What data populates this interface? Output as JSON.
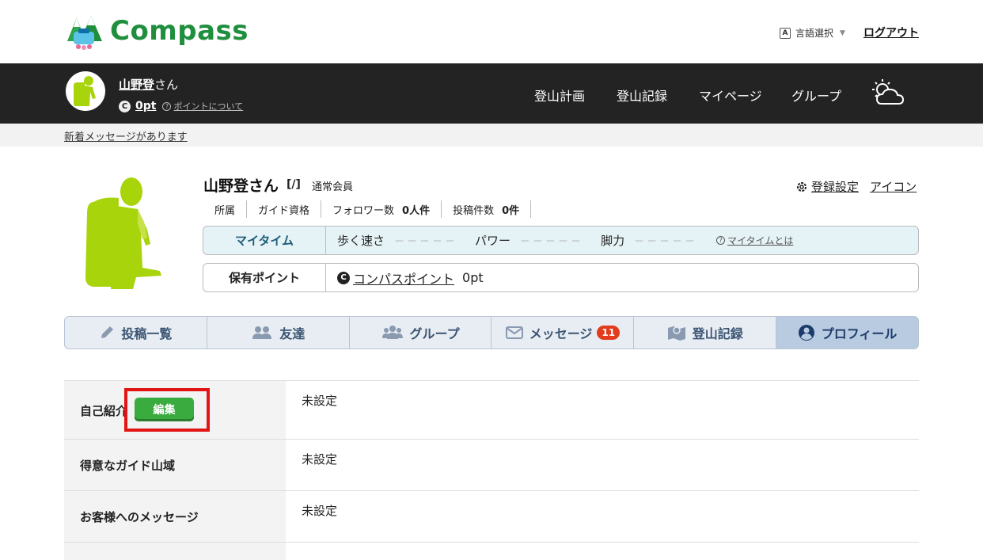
{
  "header": {
    "logo_text": "Compass",
    "language_label": "言語選択",
    "language_icon": "A",
    "logout_label": "ログアウト"
  },
  "navbar": {
    "user_name": "山野登",
    "user_suffix": "さん",
    "points": "0pt",
    "points_help": "ポイントについて",
    "menu": [
      "登山計画",
      "登山記録",
      "マイページ",
      "グループ"
    ],
    "weather_icon": "weather-cloud-sun-icon"
  },
  "notice": {
    "message": "新着メッセージがあります"
  },
  "profile": {
    "name": "山野登さん",
    "rank": "[/]",
    "member_type": "通常会員",
    "settings_label": "登録設定",
    "icon_label": "アイコン",
    "stats": {
      "affiliation": "所属",
      "guide_license": "ガイド資格",
      "followers_label": "フォロワー数",
      "followers_value": "0人件",
      "posts_label": "投稿件数",
      "posts_value": "0件"
    },
    "mytime": {
      "title": "マイタイム",
      "walk_speed": "歩く速さ",
      "power": "パワー",
      "leg_strength": "脚力",
      "placeholder": "－－－－－",
      "help": "マイタイムとは"
    },
    "points_box": {
      "title": "保有ポイント",
      "label": "コンパスポイント",
      "value": "0pt"
    }
  },
  "tabs": [
    {
      "label": "投稿一覧",
      "icon": "pencil-icon"
    },
    {
      "label": "友達",
      "icon": "friends-icon"
    },
    {
      "label": "グループ",
      "icon": "group-icon"
    },
    {
      "label": "メッセージ",
      "icon": "envelope-icon",
      "badge": "11"
    },
    {
      "label": "登山記録",
      "icon": "map-icon"
    },
    {
      "label": "プロフィール",
      "icon": "user-circle-icon",
      "active": true
    }
  ],
  "details": [
    {
      "label": "自己紹介",
      "value": "未設定"
    },
    {
      "label": "得意なガイド山域",
      "value": "未設定"
    },
    {
      "label": "お客様へのメッセージ",
      "value": "未設定"
    }
  ],
  "edit_button": "編集",
  "colors": {
    "brand_green": "#1f8f3e",
    "navbar_bg": "#222322",
    "edit_green": "#3aab3e",
    "highlight_red": "#e21414",
    "badge_red": "#e33b1b",
    "avatar_green": "#a8d40c"
  }
}
